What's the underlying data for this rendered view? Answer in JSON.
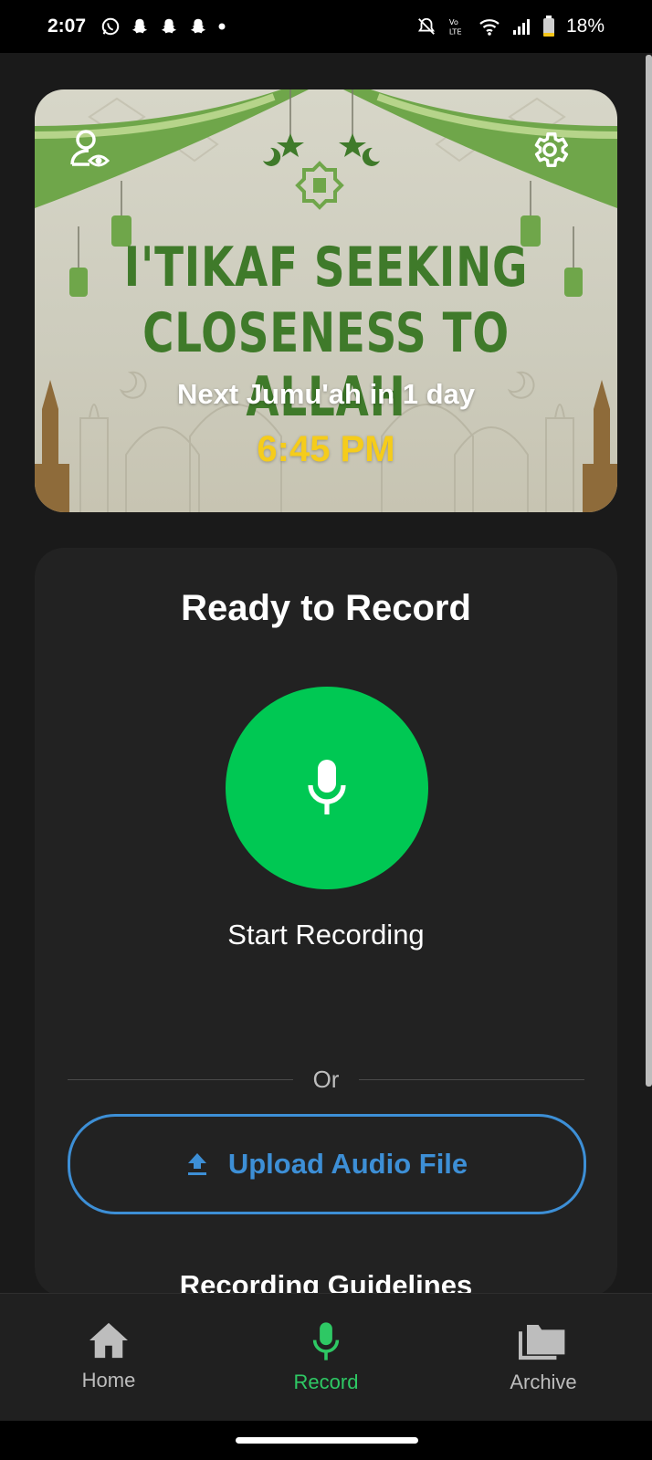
{
  "status_bar": {
    "time": "2:07",
    "battery": "18%",
    "notification_icons": [
      "whatsapp-icon",
      "snapchat-icon",
      "snapchat-icon",
      "snapchat-icon",
      "dot-icon"
    ],
    "system_icons": [
      "mute-icon",
      "volte-icon",
      "wifi-icon",
      "signal-icon",
      "battery-icon"
    ]
  },
  "banner": {
    "title_line1": "I'TIKAF SEEKING",
    "title_line2": "CLOSENESS TO ALLAH",
    "next_jumuah": "Next Jumu'ah in 1 day",
    "time": "6:45 PM",
    "left_icon": "profile-view-icon",
    "right_icon": "settings-gear-icon"
  },
  "record_card": {
    "heading": "Ready to Record",
    "mic_icon": "microphone-icon",
    "start_label": "Start Recording",
    "divider_text": "Or",
    "upload_label": "Upload Audio File",
    "upload_icon": "upload-icon",
    "guidelines_heading": "Recording Guidelines"
  },
  "bottom_nav": {
    "items": [
      {
        "label": "Home",
        "icon": "home-icon",
        "active": false
      },
      {
        "label": "Record",
        "icon": "microphone-icon",
        "active": true
      },
      {
        "label": "Archive",
        "icon": "folder-stack-icon",
        "active": false
      }
    ]
  },
  "colors": {
    "accent_green": "#00c853",
    "nav_active": "#2ec864",
    "upload_blue": "#3d8fd6",
    "banner_time": "#f5cc1b",
    "banner_title": "#3f7a2a"
  }
}
